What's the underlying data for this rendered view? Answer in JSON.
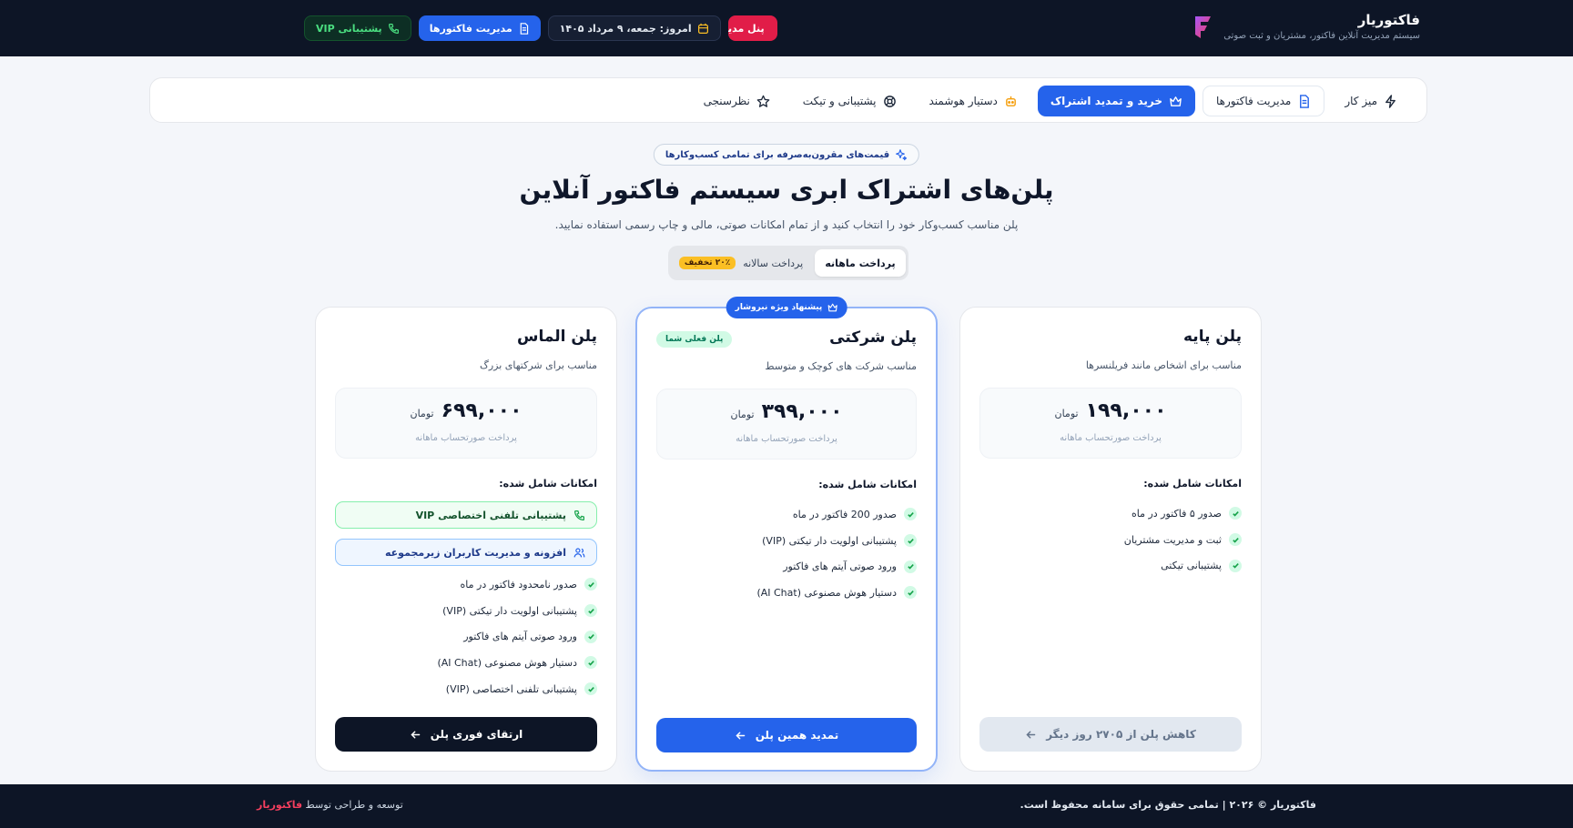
{
  "header": {
    "brand_name": "فاکتوریار",
    "brand_tagline": "سیستم مدیریت آنلاین فاکتور، مشتریان و ثبت صوتی",
    "vip_support": "پشتیبانی VIP",
    "manage_invoices": "مدیریت فاکتورها",
    "today": "امروز: جمعه، ۹ مرداد ۱۴۰۵",
    "panel": "پنل مدیریت"
  },
  "nav": {
    "dashboard": "میز کار",
    "invoices": "مدیریت فاکتورها",
    "subscription": "خرید و تمدید اشتراک",
    "assistant": "دستیار هوشمند",
    "support": "پشتیبانی و تیکت",
    "reviews": "نظرسنجی"
  },
  "hero": {
    "badge": "قیمت‌های مقرون‌به‌صرفه برای تمامی کسب‌وکارها",
    "title": "پلن‌های اشتراک ابری سیستم فاکتور آنلاین",
    "subtitle": "پلن مناسب کسب‌وکار خود را انتخاب کنید و از تمام امکانات صوتی، مالی و چاپ رسمی استفاده نمایید."
  },
  "billing": {
    "monthly": "پرداخت ماهانه",
    "yearly": "پرداخت سالانه",
    "discount": "۲۰٪ تخفیف",
    "selected": "monthly"
  },
  "plans": {
    "diamond": {
      "name": "پلن الماس",
      "desc": "مناسب برای شرکتهای بزرگ",
      "price": "۶۹۹,۰۰۰",
      "currency": "تومان",
      "price_note": "پرداخت صورتحساب ماهانه",
      "features_title": "امکانات شامل شده:",
      "highlight_vip": "پشتیبانی تلفنی اختصاصی VIP",
      "highlight_users": "افزونه و مدیریت کاربران زیرمجموعه",
      "features": [
        "صدور نامحدود فاکتور در ماه",
        "پشتیبانی اولویت دار تیکتی (VIP)",
        "ورود صوتی آیتم های فاکتور",
        "دستیار هوش مصنوعی (AI Chat)",
        "پشتیبانی تلفنی اختصاصی (VIP)"
      ],
      "cta": "ارتقای فوری پلن"
    },
    "corporate": {
      "name": "پلن شرکتی",
      "featured_tag": "پیشنهاد ویژه نیروشار",
      "current_badge": "پلن فعلی شما",
      "desc": "مناسب شرکت های کوچک و متوسط",
      "price": "۳۹۹,۰۰۰",
      "currency": "تومان",
      "price_note": "پرداخت صورتحساب ماهانه",
      "features_title": "امکانات شامل شده:",
      "features": [
        "صدور 200 فاکتور در ماه",
        "پشتیبانی اولویت دار تیکتی (VIP)",
        "ورود صوتی آیتم های فاکتور",
        "دستیار هوش مصنوعی (AI Chat)"
      ],
      "cta": "تمدید همین پلن"
    },
    "basic": {
      "name": "پلن پایه",
      "desc": "مناسب برای اشخاص مانند فریلنسرها",
      "price": "۱۹۹,۰۰۰",
      "currency": "تومان",
      "price_note": "پرداخت صورتحساب ماهانه",
      "features_title": "امکانات شامل شده:",
      "features": [
        "صدور ۵ فاکتور در ماه",
        "ثبت و مدیریت مشتریان",
        "پشتیبانی تیکتی"
      ],
      "cta": "کاهش پلن از ۲۷۰۵ روز دیگر"
    }
  },
  "footer": {
    "copyright": "فاکتوریار © ۲۰۲۶ | تمامی حقوق برای سامانه محفوظ است.",
    "dev_prefix": "توسعه و طراحی توسط",
    "dev_brand": "فاکتوریار"
  },
  "colors": {
    "dark": "#0d1526",
    "primary": "#2563eb",
    "success": "#16a34a",
    "danger": "#e11d48",
    "discount": "#fbbf24"
  }
}
